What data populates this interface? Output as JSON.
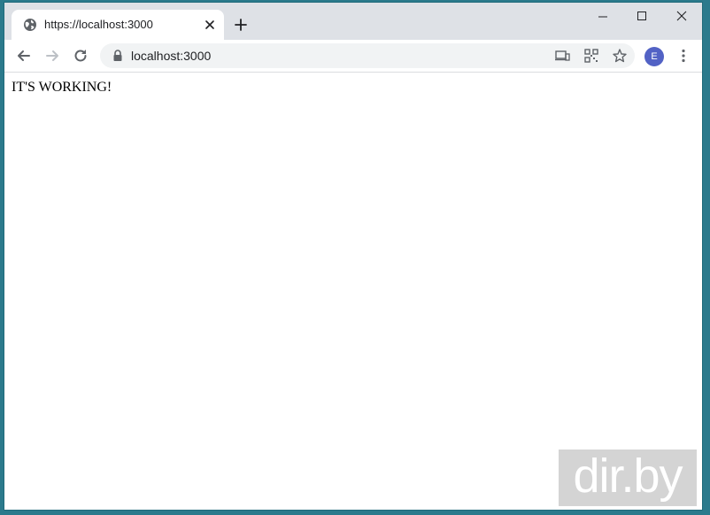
{
  "tab": {
    "title": "https://localhost:3000",
    "favicon": "globe-icon"
  },
  "window_controls": {
    "minimize": "minimize-icon",
    "maximize": "maximize-icon",
    "close": "close-icon"
  },
  "toolbar": {
    "url": "localhost:3000",
    "profile_initial": "E"
  },
  "page": {
    "text": "IT'S WORKING!"
  },
  "watermark": {
    "text": "dir.by"
  },
  "colors": {
    "titlebar": "#dee1e6",
    "omnibox": "#f1f3f4",
    "avatar": "#5262c5",
    "desktop": "#2b7a8c"
  }
}
